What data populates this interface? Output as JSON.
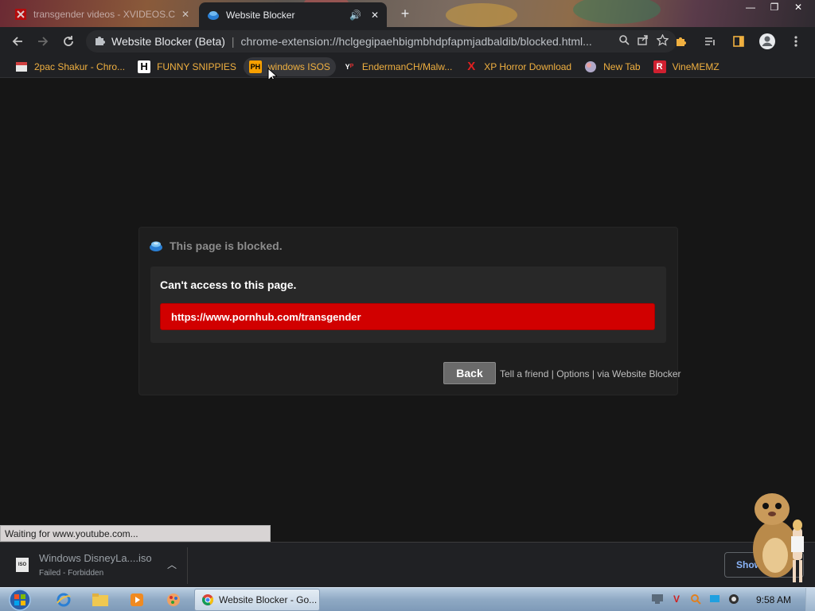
{
  "browser": {
    "tabs": [
      {
        "label": "transgender videos - XVIDEOS.C",
        "active": false
      },
      {
        "label": "Website Blocker",
        "active": true
      }
    ],
    "omnibox": {
      "site_name": "Website Blocker (Beta)",
      "url": "chrome-extension://hclgegipaehbigmbhdpfapmjadbaldib/blocked.html..."
    },
    "bookmarks": [
      {
        "label": "2pac Shakur - Chro...",
        "icon": "page-icon"
      },
      {
        "label": "FUNNY SNIPPIES",
        "icon": "H"
      },
      {
        "label": "windows ISOS",
        "icon": "PH"
      },
      {
        "label": "EndermanCH/Malw...",
        "icon": "YT"
      },
      {
        "label": "XP Horror Download",
        "icon": "X"
      },
      {
        "label": "New Tab",
        "icon": "globe-icon"
      },
      {
        "label": "VineMEMZ",
        "icon": "R"
      }
    ]
  },
  "blocked_page": {
    "header": "This page is blocked.",
    "message": "Can't access to this page.",
    "blocked_url": "https://www.pornhub.com/transgender",
    "back_label": "Back",
    "links": {
      "tell_friend": "Tell a friend",
      "options": "Options",
      "via": "via Website Blocker",
      "separator": "|"
    }
  },
  "status_text": "Waiting for www.youtube.com...",
  "downloads": {
    "item": {
      "name": "Windows DisneyLa....iso",
      "status": "Failed - Forbidden",
      "icon_text": "ISO"
    },
    "show_all": "Show all"
  },
  "taskbar": {
    "active_task": "Website Blocker - Go...",
    "clock": "9:58 AM"
  },
  "colors": {
    "blocked_bar": "#d10000",
    "bookmark_text": "#f0b040",
    "page_bg": "#161616"
  }
}
